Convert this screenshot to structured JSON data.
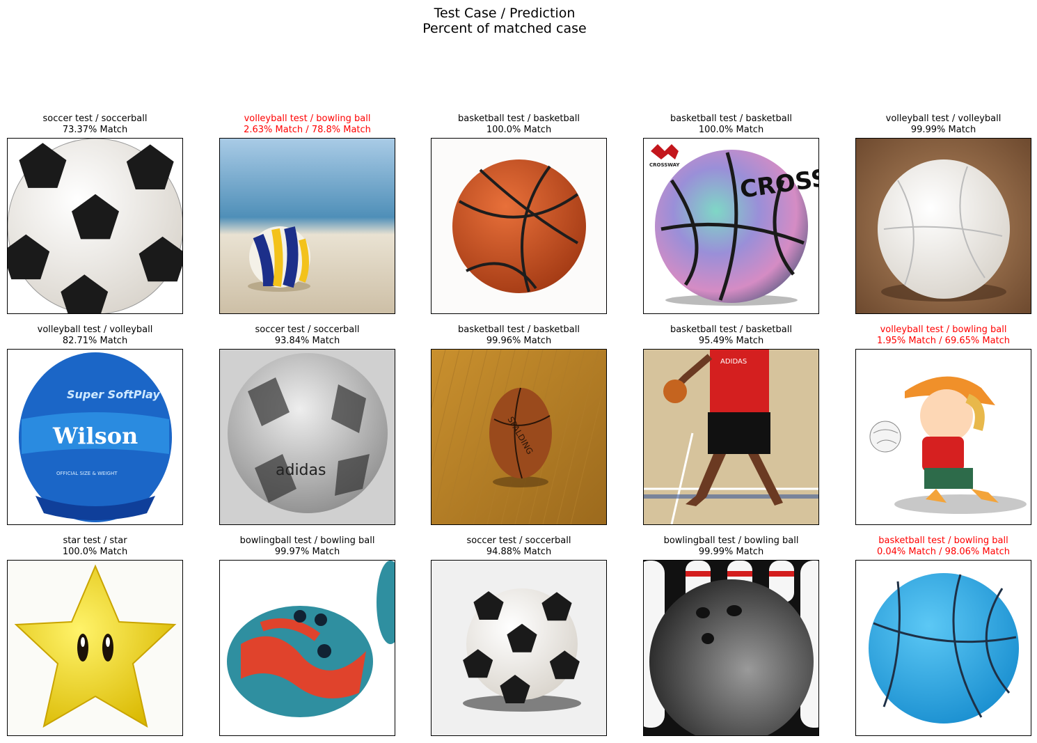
{
  "figure": {
    "title": "Test Case / Prediction\nPercent of matched case",
    "mismatch_color": "#ff0000",
    "match_color": "#000000"
  },
  "panels": [
    {
      "label": "soccer test / soccerball\n73.37% Match",
      "mismatch": false,
      "image": "soccer-ball-image"
    },
    {
      "label": "volleyball test / bowling ball\n2.63% Match / 78.8% Match",
      "mismatch": true,
      "image": "volleyball-on-beach-image"
    },
    {
      "label": "basketball test / basketball\n100.0% Match",
      "mismatch": false,
      "image": "basketball-image"
    },
    {
      "label": "basketball test / basketball\n100.0% Match",
      "mismatch": false,
      "image": "holographic-basketball-image"
    },
    {
      "label": "volleyball test / volleyball\n99.99% Match",
      "mismatch": false,
      "image": "white-volleyball-on-sand-image"
    },
    {
      "label": "volleyball test / volleyball\n82.71% Match",
      "mismatch": false,
      "image": "blue-volleyball-image"
    },
    {
      "label": "soccer test / soccerball\n93.84% Match",
      "mismatch": false,
      "image": "silver-soccer-ball-image"
    },
    {
      "label": "basketball test / basketball\n99.96% Match",
      "mismatch": false,
      "image": "basketball-on-court-image"
    },
    {
      "label": "basketball test / basketball\n95.49% Match",
      "mismatch": false,
      "image": "player-dribbling-image"
    },
    {
      "label": "volleyball test / bowling ball\n1.95% Match / 69.65% Match",
      "mismatch": true,
      "image": "cartoon-kid-volleyball-image"
    },
    {
      "label": "star test / star\n100.0% Match",
      "mismatch": false,
      "image": "yellow-star-image"
    },
    {
      "label": "bowlingball test / bowling ball\n99.97% Match",
      "mismatch": false,
      "image": "swirl-bowling-ball-image"
    },
    {
      "label": "soccer test / soccerball\n94.88% Match",
      "mismatch": false,
      "image": "soccer-ball-shadow-image"
    },
    {
      "label": "bowlingball test / bowling ball\n99.99% Match",
      "mismatch": false,
      "image": "bowling-ball-pins-image"
    },
    {
      "label": "basketball test / bowling ball\n0.04% Match / 98.06% Match",
      "mismatch": true,
      "image": "blue-basketball-image"
    }
  ],
  "logos": {
    "crossway_label": "CROSSWAY",
    "cross_text": "CROSS",
    "super_softplay": "Super SoftPlay",
    "wilson": "Wilson",
    "wilson_sub": "OFFICIAL SIZE & WEIGHT",
    "adidas": "adidas",
    "spalding": "SPALDING",
    "jersey_text": "ADIDAS"
  }
}
